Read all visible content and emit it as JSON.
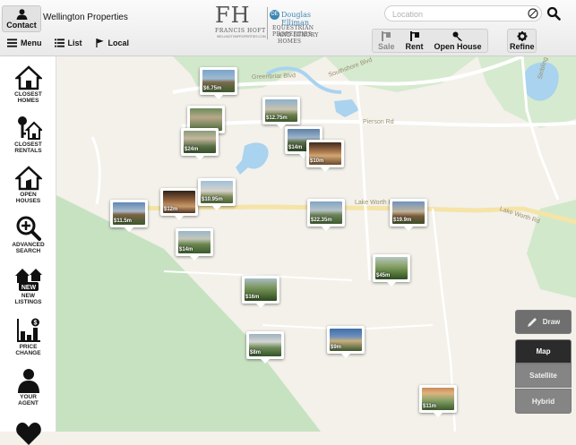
{
  "header": {
    "contact_label": "Contact",
    "app_title": "Wellington Properties",
    "nav": {
      "menu": "Menu",
      "list": "List",
      "local": "Local"
    },
    "search_placeholder": "Location",
    "toolbar": {
      "sale": "Sale",
      "rent": "Rent",
      "open_house": "Open House",
      "refine": "Refine"
    }
  },
  "logo": {
    "initials": "FH",
    "name": "FRANCIS HOFT",
    "website": "WELLINGTONPROPERTIES.COM",
    "partner": "Douglas Elliman",
    "tagline1": "EQUESTRIAN PROPERTIES",
    "tagline2": "AND LUXURY HOMES"
  },
  "sidebar": {
    "items": [
      {
        "label": "CLOSEST\nHOMES",
        "icon": "house-icon"
      },
      {
        "label": "CLOSEST\nRENTALS",
        "icon": "rental-key-icon"
      },
      {
        "label": "OPEN\nHOUSES",
        "icon": "open-house-icon"
      },
      {
        "label": "ADVANCED\nSEARCH",
        "icon": "magnifier-plus-icon"
      },
      {
        "label": "NEW\nLISTINGS",
        "icon": "new-listings-icon",
        "badge": "NEW"
      },
      {
        "label": "PRICE\nCHANGE",
        "icon": "price-change-icon"
      },
      {
        "label": "YOUR\nAGENT",
        "icon": "agent-icon"
      }
    ]
  },
  "map": {
    "roads": {
      "greenbriar": "Greenbriar Blvd",
      "southshore": "Southshore Blvd",
      "pierson": "Pierson Rd",
      "lakeworth1": "Lake Worth Rd",
      "lakeworth2": "Lake Worth Rd",
      "stribling": "Stribling Way"
    },
    "pins": [
      "$6.75m",
      "$12.75m",
      "$14m",
      "$24m",
      "$10m",
      "$11.5m",
      "$12m",
      "$10.95m",
      "$22.35m",
      "$19.9m",
      "$14m",
      "$45m",
      "$16m",
      "$8m",
      "$9m",
      "$11m"
    ],
    "controls": {
      "draw": "Draw",
      "map": "Map",
      "satellite": "Satellite",
      "hybrid": "Hybrid"
    }
  }
}
